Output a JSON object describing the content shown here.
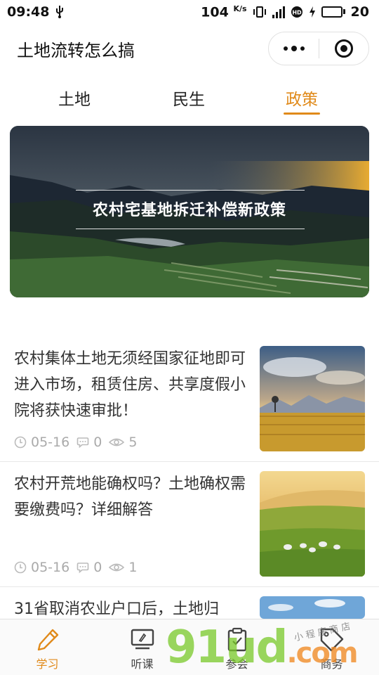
{
  "status_bar": {
    "time": "09:48",
    "net_speed": "104",
    "net_unit": "K/s",
    "battery": "20",
    "icons": [
      "usb-icon",
      "vibrate-icon",
      "signal-4g-icon",
      "hd-icon",
      "charging-icon",
      "battery-icon"
    ]
  },
  "header": {
    "title": "土地流转怎么搞",
    "capsule_icons": [
      "more-dots-icon",
      "close-target-icon"
    ]
  },
  "tabs": [
    {
      "label": "土地",
      "active": false
    },
    {
      "label": "民生",
      "active": false
    },
    {
      "label": "政策",
      "active": true
    }
  ],
  "banner": {
    "title": "农村宅基地拆迁补偿新政策"
  },
  "articles": [
    {
      "title": "农村集体土地无须经国家征地即可进入市场，租赁住房、共享度假小院将获快速审批！",
      "date": "05-16",
      "comments": "0",
      "views": "5"
    },
    {
      "title": "农村开荒地能确权吗？土地确权需要缴费吗？详细解答",
      "date": "05-16",
      "comments": "0",
      "views": "1"
    },
    {
      "title": "31省取消农业户口后，土地归"
    }
  ],
  "bottom_nav": [
    {
      "label": "学习",
      "icon": "pencil-icon",
      "active": true
    },
    {
      "label": "听课",
      "icon": "monitor-icon",
      "active": false
    },
    {
      "label": "参会",
      "icon": "clipboard-icon",
      "active": false
    },
    {
      "label": "商务",
      "icon": "tag-icon",
      "active": false
    }
  ],
  "watermark": {
    "brand": "91ud",
    "domain": ".com",
    "tagline": "小 程 序 商 店"
  },
  "colors": {
    "accent": "#e08a1a",
    "text": "#333333",
    "meta": "#aaaaaa"
  }
}
